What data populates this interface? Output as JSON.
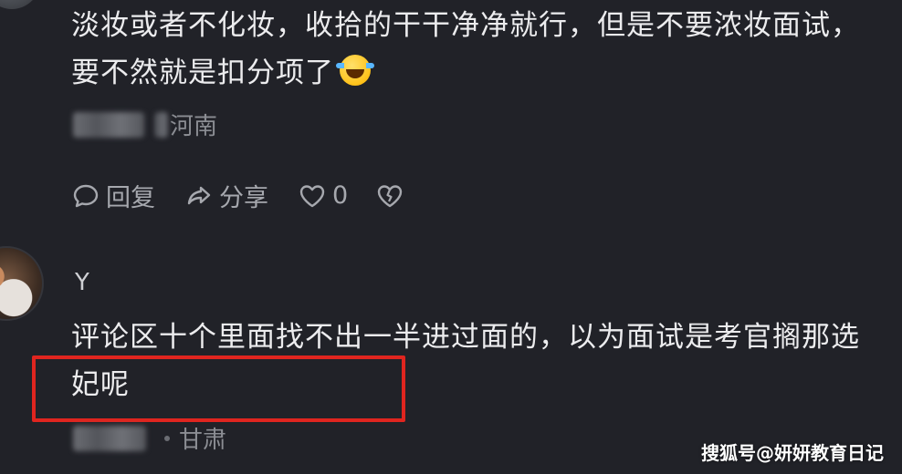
{
  "comment1": {
    "text": "淡妆或者不化妆，收拾的干干净净就行，但是不要浓妆面试，要不然就是扣分项了",
    "emoji": "laughing-crying-emoji",
    "location": "河南"
  },
  "actions": {
    "reply_label": "回复",
    "share_label": "分享",
    "like_count": "0"
  },
  "comment2": {
    "username": "Y",
    "text": "评论区十个里面找不出一半进过面的，以为面试是考官搁那选妃呢",
    "location": "甘肃"
  },
  "highlight": {
    "color": "#e0251f"
  },
  "watermark": {
    "text": "搜狐号@妍妍教育日记"
  }
}
